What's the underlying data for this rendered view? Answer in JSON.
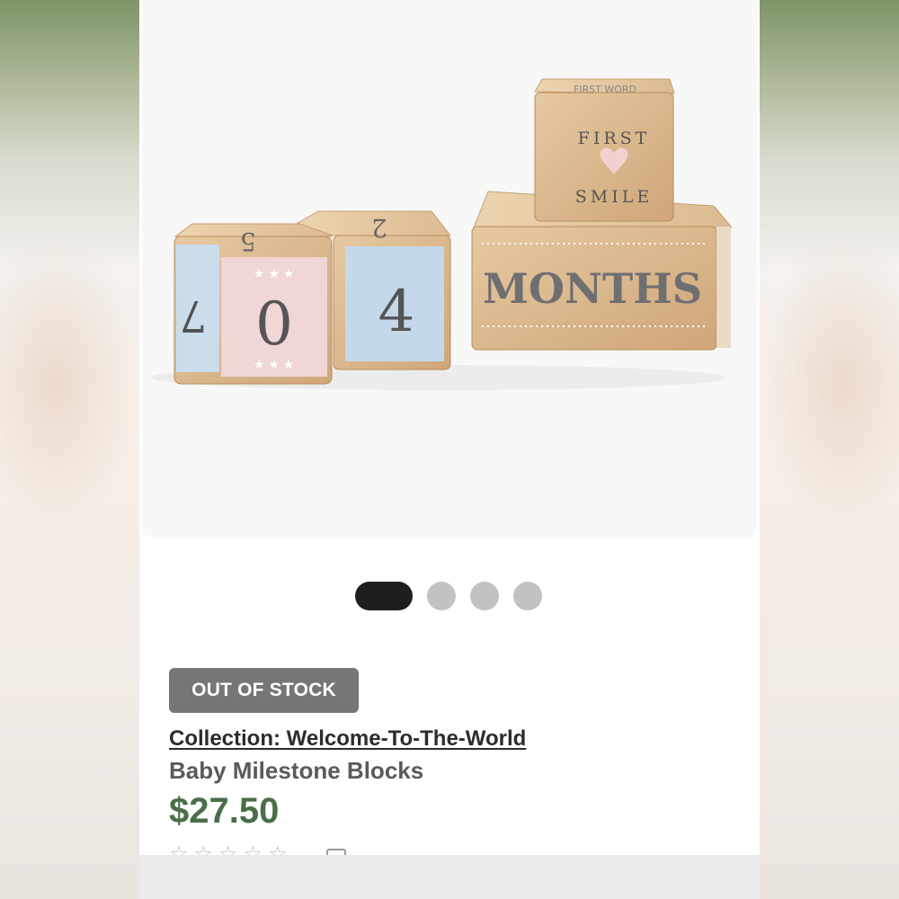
{
  "product": {
    "stock_badge": "OUT OF STOCK",
    "collection_link": "Collection: Welcome-To-The-World",
    "title": "Baby Milestone Blocks",
    "price": "$27.50",
    "rating_stars": "☆☆☆☆☆"
  },
  "gallery": {
    "image_count": 4,
    "active_index": 0,
    "blocks": {
      "cube1_face": "0",
      "cube1_side": "7",
      "cube1_top": "5",
      "cube2_face": "4",
      "cube2_top": "2",
      "small_top_text": "FIRST WORD",
      "small_arc_top": "FIRST",
      "small_arc_bottom": "SMILE",
      "rect_text": "MONTHS"
    }
  },
  "colors": {
    "accent_price": "#4a6e48",
    "badge_bg": "#767676",
    "dot_active": "#1e1e1e",
    "dot_inactive": "#c2c2c2"
  }
}
